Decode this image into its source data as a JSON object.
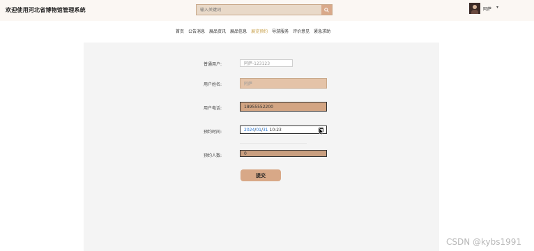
{
  "header": {
    "title": "欢迎使用河北省博物馆管理系统",
    "search": {
      "placeholder": "输入关键词",
      "value": ""
    },
    "user": {
      "name": "阿萨",
      "caret": "▾"
    }
  },
  "nav": {
    "items": [
      {
        "label": "首页",
        "active": false
      },
      {
        "label": "公告消息",
        "active": false
      },
      {
        "label": "展品资讯",
        "active": false
      },
      {
        "label": "展品信息",
        "active": false
      },
      {
        "label": "展览预约",
        "active": true
      },
      {
        "label": "导游服务",
        "active": false
      },
      {
        "label": "评价意见",
        "active": false
      },
      {
        "label": "紧急求助",
        "active": false
      }
    ]
  },
  "form": {
    "user_account": {
      "label": "普通用户:",
      "value": "阿萨-123123"
    },
    "user_name": {
      "label": "用户姓名:",
      "value": "阿萨"
    },
    "user_phone": {
      "label": "用户电话:",
      "value": "18955552200"
    },
    "booking_time": {
      "label": "预约时间:",
      "year": "2024",
      "month": "01",
      "day": "31",
      "time": "10:23"
    },
    "people_count": {
      "label": "预约人数:",
      "value": "0"
    },
    "submit_label": "提交"
  },
  "watermark": "CSDN @kybs1991"
}
